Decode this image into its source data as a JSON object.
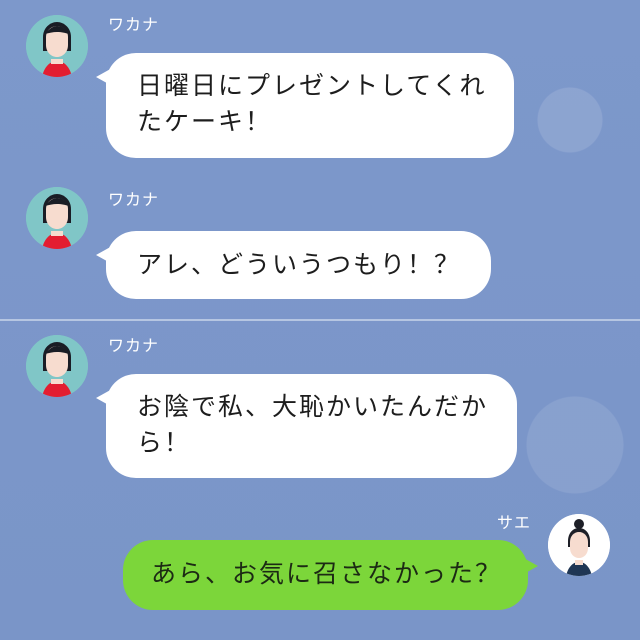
{
  "chat": {
    "messages": [
      {
        "sender": "ワカナ",
        "text": "日曜日にプレゼントしてくれ\nたケーキ！"
      },
      {
        "sender": "ワカナ",
        "text": "アレ、どういうつもり！？"
      },
      {
        "sender": "ワカナ",
        "text": "お陰で私、大恥かいたんだか\nら！"
      },
      {
        "sender": "サエ",
        "text": "あら、お気に召さなかった？"
      }
    ]
  },
  "icons": {
    "left_avatar": "woman-avatar-red-top",
    "right_avatar": "woman-avatar-bun"
  },
  "colors": {
    "chat_background": "#7b96c9",
    "incoming_bubble": "#ffffff",
    "outgoing_bubble": "#7cd63a",
    "avatar_left_background": "#80c6c7",
    "avatar_right_background": "#ffffff"
  }
}
